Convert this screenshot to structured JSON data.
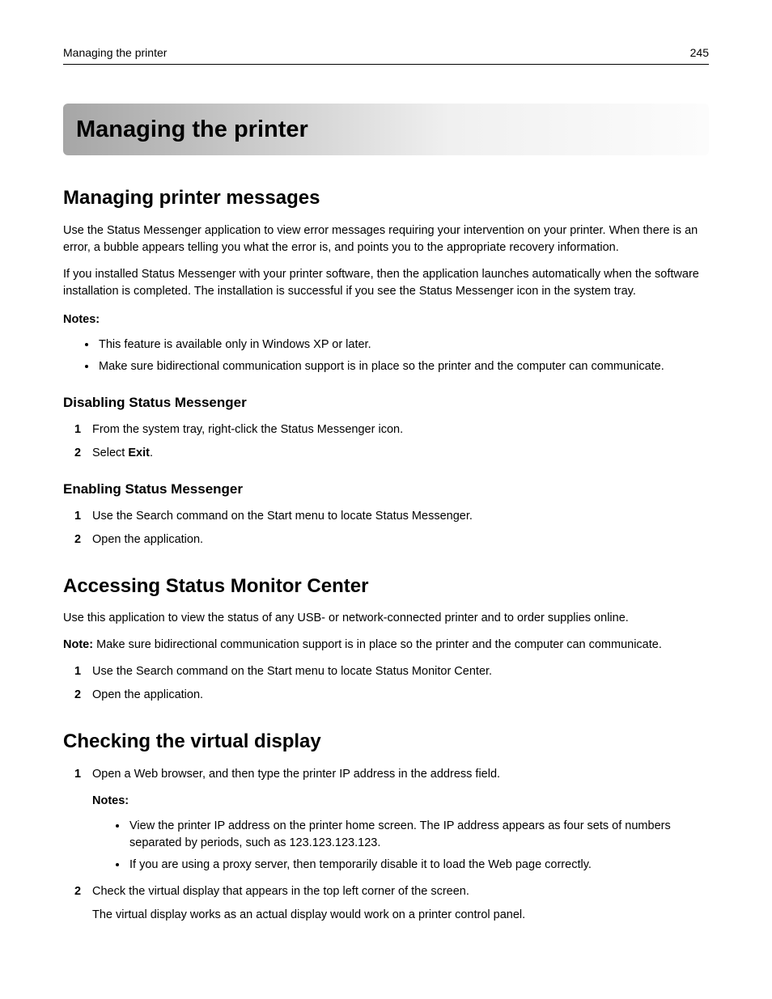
{
  "header": {
    "running_title": "Managing the printer",
    "page_number": "245"
  },
  "page_title": "Managing the printer",
  "sections": {
    "s1": {
      "heading": "Managing printer messages",
      "p1": "Use the Status Messenger application to view error messages requiring your intervention on your printer. When there is an error, a bubble appears telling you what the error is, and points you to the appropriate recovery information.",
      "p2": "If you installed Status Messenger with your printer software, then the application launches automatically when the software installation is completed. The installation is successful if you see the Status Messenger icon in the system tray.",
      "notes_label": "Notes:",
      "notes": [
        "This feature is available only in Windows XP or later.",
        "Make sure bidirectional communication support is in place so the printer and the computer can communicate."
      ],
      "sub1": {
        "heading": "Disabling Status Messenger",
        "steps": [
          {
            "text": "From the system tray, right‑click the Status Messenger icon."
          },
          {
            "prefix": "Select ",
            "bold": "Exit",
            "suffix": "."
          }
        ]
      },
      "sub2": {
        "heading": "Enabling Status Messenger",
        "steps": [
          {
            "text": "Use the Search command on the Start menu to locate Status Messenger."
          },
          {
            "text": "Open the application."
          }
        ]
      }
    },
    "s2": {
      "heading": "Accessing Status Monitor Center",
      "p1": "Use this application to view the status of any USB‑ or network‑connected printer and to order supplies online.",
      "note_prefix": "Note:",
      "note_body": " Make sure bidirectional communication support is in place so the printer and the computer can communicate.",
      "steps": [
        {
          "text": "Use the Search command on the Start menu to locate Status Monitor Center."
        },
        {
          "text": "Open the application."
        }
      ]
    },
    "s3": {
      "heading": "Checking the virtual display",
      "steps": {
        "step1": {
          "text": "Open a Web browser, and then type the printer IP address in the address field.",
          "notes_label": "Notes:",
          "notes": [
            "View the printer IP address on the printer home screen. The IP address appears as four sets of numbers separated by periods, such as 123.123.123.123.",
            "If you are using a proxy server, then temporarily disable it to load the Web page correctly."
          ]
        },
        "step2": {
          "text": "Check the virtual display that appears in the top left corner of the screen.",
          "followup": "The virtual display works as an actual display would work on a printer control panel."
        }
      }
    }
  }
}
